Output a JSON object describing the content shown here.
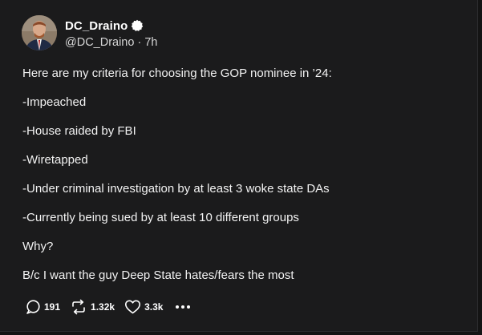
{
  "author": {
    "display_name": "DC_Draino",
    "handle": "@DC_Draino",
    "separator": "·",
    "time_ago": "7h",
    "verified_icon": "verified-badge-icon",
    "avatar_icon": "avatar"
  },
  "post": {
    "lines": [
      "Here are my criteria for choosing the GOP nominee in ’24:",
      "-Impeached",
      "-House raided by FBI",
      "-Wiretapped",
      "-Under criminal investigation by at least 3 woke state DAs",
      "-Currently being sued by at least 10 different groups",
      "Why?",
      "B/c I want the guy Deep State hates/fears the most"
    ]
  },
  "actions": {
    "replies": {
      "icon": "reply-icon",
      "count": "191"
    },
    "reposts": {
      "icon": "repost-icon",
      "count": "1.32k"
    },
    "likes": {
      "icon": "heart-icon",
      "count": "3.3k"
    },
    "more": {
      "icon": "more-options-icon"
    }
  },
  "colors": {
    "background": "#1b1b1c",
    "text": "#f2f2f2",
    "secondary_text": "#d6d6d6"
  }
}
